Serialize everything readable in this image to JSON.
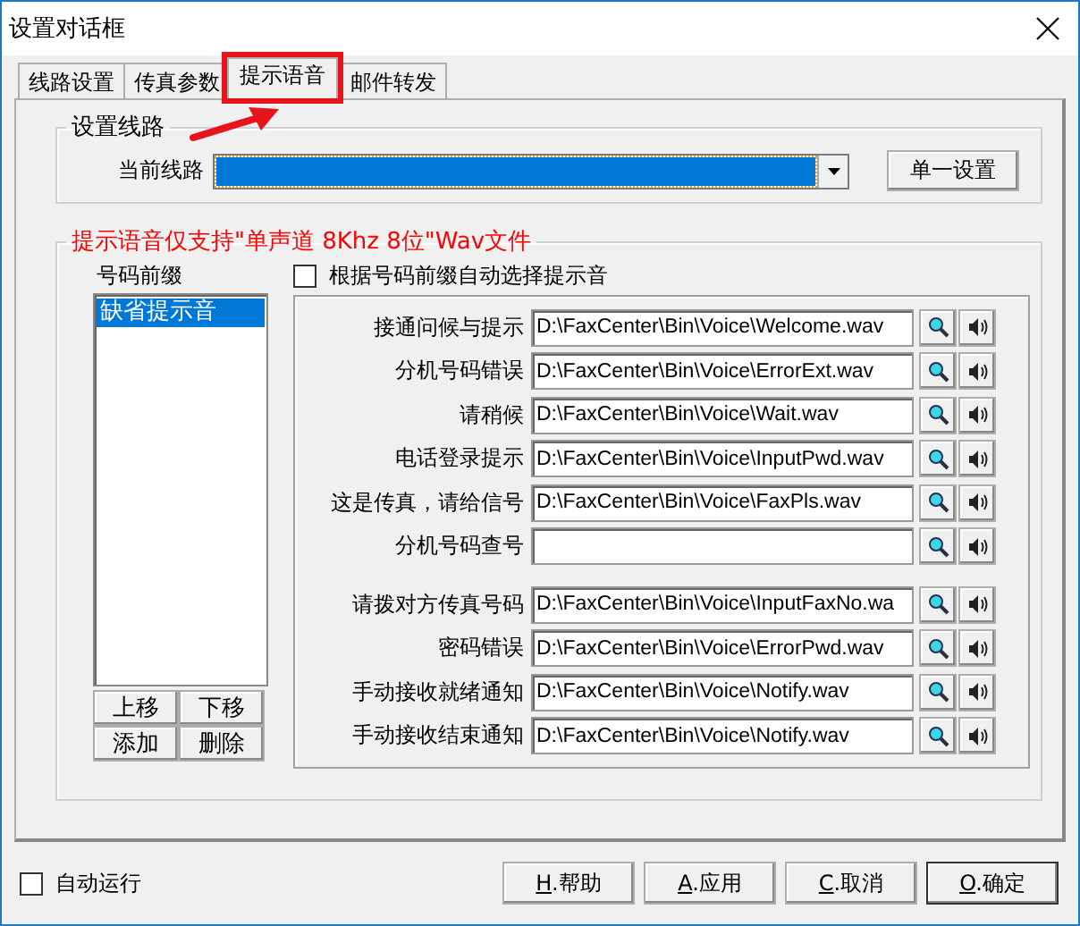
{
  "window": {
    "title": "设置对话框"
  },
  "tabs": [
    {
      "label": "线路设置",
      "selected": false,
      "highlighted": false
    },
    {
      "label": "传真参数",
      "selected": false,
      "highlighted": false
    },
    {
      "label": "提示语音",
      "selected": true,
      "highlighted": true
    },
    {
      "label": "邮件转发",
      "selected": false,
      "highlighted": false
    }
  ],
  "pointer_arrow": true,
  "line_group": {
    "title": "设置线路",
    "label": "当前线路",
    "combo_focused": true,
    "button": "单一设置"
  },
  "voice_group": {
    "title": "提示语音仅支持\"单声道 8Khz 8位\"Wav文件",
    "prefix_label": "号码前缀",
    "prefix_list": [
      {
        "label": "缺省提示音",
        "selected": true
      }
    ],
    "list_buttons": [
      "上移",
      "下移",
      "添加",
      "删除"
    ],
    "auto_select": {
      "label": "根据号码前缀自动选择提示音",
      "checked": false
    },
    "prompt_groups": [
      [
        {
          "label": "接通问候与提示",
          "value": "D:\\FaxCenter\\Bin\\Voice\\Welcome.wav"
        },
        {
          "label": "分机号码错误",
          "value": "D:\\FaxCenter\\Bin\\Voice\\ErrorExt.wav"
        },
        {
          "label": "请稍候",
          "value": "D:\\FaxCenter\\Bin\\Voice\\Wait.wav"
        },
        {
          "label": "电话登录提示",
          "value": "D:\\FaxCenter\\Bin\\Voice\\InputPwd.wav"
        },
        {
          "label": "这是传真，请给信号",
          "value": "D:\\FaxCenter\\Bin\\Voice\\FaxPls.wav"
        },
        {
          "label": "分机号码查号"
        }
      ],
      [
        {
          "label": "请拨对方传真号码",
          "value": "D:\\FaxCenter\\Bin\\Voice\\InputFaxNo.wa"
        },
        {
          "label": "密码错误",
          "value": "D:\\FaxCenter\\Bin\\Voice\\ErrorPwd.wav"
        },
        {
          "label": "手动接收就绪通知",
          "value": "D:\\FaxCenter\\Bin\\Voice\\Notify.wav"
        },
        {
          "label": "手动接收结束通知",
          "value": "D:\\FaxCenter\\Bin\\Voice\\Notify.wav"
        }
      ]
    ]
  },
  "auto_run": {
    "label": "自动运行",
    "checked": false
  },
  "buttons": [
    {
      "key": "H",
      "label": ".帮助"
    },
    {
      "key": "A",
      "label": ".应用"
    },
    {
      "key": "C",
      "label": ".取消"
    },
    {
      "key": "O",
      "label": ".确定",
      "default": true
    }
  ]
}
